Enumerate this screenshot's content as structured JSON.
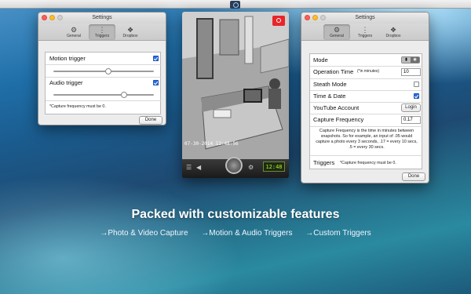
{
  "menubar": {
    "icon": "app-camera-icon"
  },
  "left_window": {
    "title": "Settings",
    "tabs": [
      {
        "label": "General",
        "icon": "gear-icon",
        "glyph": "⚙"
      },
      {
        "label": "Triggers",
        "icon": "triggers-icon",
        "glyph": "⋮"
      },
      {
        "label": "Dropbox",
        "icon": "dropbox-icon",
        "glyph": "❖"
      }
    ],
    "motion_label": "Motion trigger",
    "motion_checked": true,
    "motion_level": 0.55,
    "audio_label": "Audio trigger",
    "audio_checked": true,
    "audio_level": 0.72,
    "note": "*Capture frequency must be 0.",
    "done": "Done"
  },
  "camera": {
    "timestamp": "07-30-2014 12:48:56",
    "counter": "12:48",
    "camera_icon": "camera-icon",
    "shutter_icon": "shutter-icon",
    "gear_icon": "gear-icon",
    "menu_icon": "menu-icon",
    "speaker_icon": "speaker-icon"
  },
  "right_window": {
    "title": "Settings",
    "tabs": [
      {
        "label": "General",
        "icon": "gear-icon",
        "glyph": "⚙"
      },
      {
        "label": "Triggers",
        "icon": "triggers-icon",
        "glyph": "⋮"
      },
      {
        "label": "Dropbox",
        "icon": "dropbox-icon",
        "glyph": "❖"
      }
    ],
    "mode_label": "Mode",
    "operation_time_label": "Operation Time",
    "operation_time_hint": "(*in minutes)",
    "operation_time_value": "10",
    "stealth_label": "Steath Mode",
    "stealth_checked": false,
    "time_date_label": "Time & Date",
    "time_date_checked": true,
    "youtube_label": "YouTube Account",
    "login": "Login",
    "capture_label": "Capture Frequency",
    "capture_value": "0.17",
    "description": "Capture Frequency is the time in minutes between snapshots. So for example, an input of .05 would capture a photo every 3 seconds, .17 = every 10 secs, .5 = every 30 secs.",
    "triggers_label": "Triggers",
    "triggers_note": "*Capture frequency must be 0.",
    "done": "Done"
  },
  "headline": "Packed with customizable features",
  "features": [
    "→Photo & Video Capture",
    "→Motion & Audio Triggers",
    "→Custom Triggers"
  ]
}
